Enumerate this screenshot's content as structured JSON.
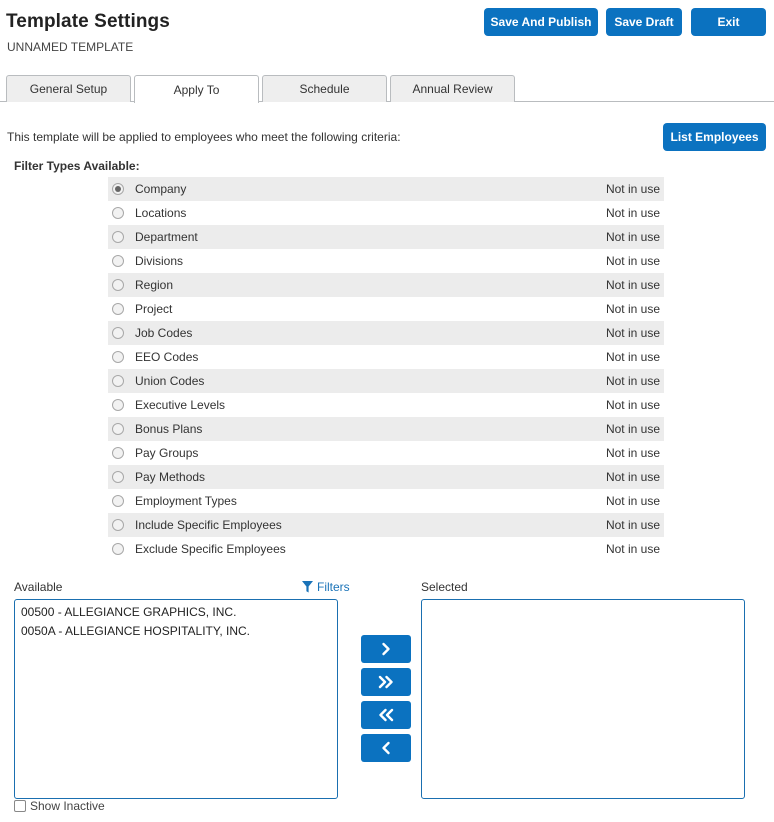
{
  "header": {
    "title": "Template Settings",
    "subtitle": "UNNAMED TEMPLATE",
    "save_publish_label": "Save And Publish",
    "save_draft_label": "Save Draft",
    "exit_label": "Exit"
  },
  "tabs": [
    {
      "label": "General Setup",
      "active": false
    },
    {
      "label": "Apply To",
      "active": true
    },
    {
      "label": "Schedule",
      "active": false
    },
    {
      "label": "Annual Review",
      "active": false
    }
  ],
  "intro_text": "This template will be applied to employees who meet the following criteria:",
  "list_employees_label": "List Employees",
  "filter_heading": "Filter Types Available:",
  "filters": [
    {
      "label": "Company",
      "status": "Not in use",
      "checked": true
    },
    {
      "label": "Locations",
      "status": "Not in use",
      "checked": false
    },
    {
      "label": "Department",
      "status": "Not in use",
      "checked": false
    },
    {
      "label": "Divisions",
      "status": "Not in use",
      "checked": false
    },
    {
      "label": "Region",
      "status": "Not in use",
      "checked": false
    },
    {
      "label": "Project",
      "status": "Not in use",
      "checked": false
    },
    {
      "label": "Job Codes",
      "status": "Not in use",
      "checked": false
    },
    {
      "label": "EEO Codes",
      "status": "Not in use",
      "checked": false
    },
    {
      "label": "Union Codes",
      "status": "Not in use",
      "checked": false
    },
    {
      "label": "Executive Levels",
      "status": "Not in use",
      "checked": false
    },
    {
      "label": "Bonus Plans",
      "status": "Not in use",
      "checked": false
    },
    {
      "label": "Pay Groups",
      "status": "Not in use",
      "checked": false
    },
    {
      "label": "Pay Methods",
      "status": "Not in use",
      "checked": false
    },
    {
      "label": "Employment Types",
      "status": "Not in use",
      "checked": false
    },
    {
      "label": "Include Specific Employees",
      "status": "Not in use",
      "checked": false
    },
    {
      "label": "Exclude Specific Employees",
      "status": "Not in use",
      "checked": false
    }
  ],
  "available": {
    "label": "Available",
    "filters_link": "Filters",
    "items": [
      "00500 - ALLEGIANCE GRAPHICS, INC.",
      "0050A - ALLEGIANCE HOSPITALITY, INC."
    ]
  },
  "selected": {
    "label": "Selected",
    "items": []
  },
  "show_inactive_label": "Show Inactive",
  "colors": {
    "primary": "#0b72c0",
    "link": "#1a73b8",
    "row_stripe": "#ececec"
  }
}
